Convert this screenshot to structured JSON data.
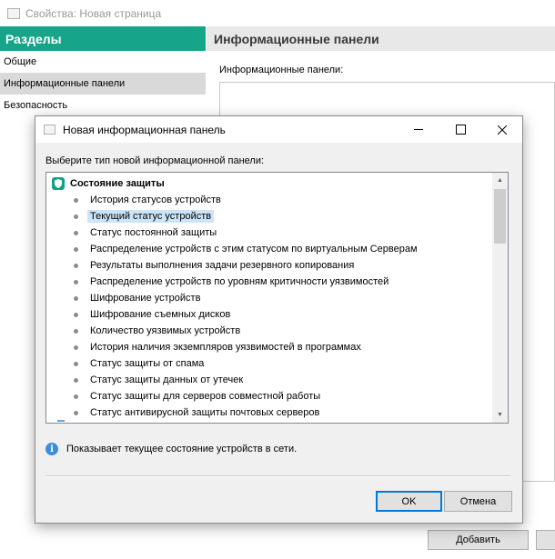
{
  "window": {
    "title": "Свойства: Новая страница"
  },
  "sidebar": {
    "header": "Разделы",
    "items": [
      {
        "label": "Общие"
      },
      {
        "label": "Информационные панели"
      },
      {
        "label": "Безопасность"
      }
    ]
  },
  "content": {
    "header": "Информационные панели",
    "label": "Информационные панели:",
    "add_button": "Добавить"
  },
  "dialog": {
    "title": "Новая информационная панель",
    "prompt": "Выберите тип новой информационной панели:",
    "group": "Состояние защиты",
    "items": [
      "История статусов устройств",
      "Текущий статус устройств",
      "Статус постоянной защиты",
      "Распределение устройств с этим статусом по виртуальным Серверам",
      "Результаты выполнения задачи резервного копирования",
      "Распределение устройств по уровням критичности уязвимостей",
      "Шифрование устройств",
      "Шифрование съемных дисков",
      "Количество уязвимых устройств",
      "История наличия экземпляров уязвимостей в программах",
      "Статус защиты от спама",
      "Статус защиты данных от утечек",
      "Статус защиты для серверов совместной работы",
      "Статус антивирусной защиты почтовых серверов"
    ],
    "selected_index": 1,
    "info_text": "Показывает текущее состояние устройств в сети.",
    "ok_label": "OK",
    "cancel_label": "Отмена"
  },
  "colors": {
    "accent": "#17a589",
    "selection": "#cce4f7",
    "info": "#3a8fd6"
  }
}
